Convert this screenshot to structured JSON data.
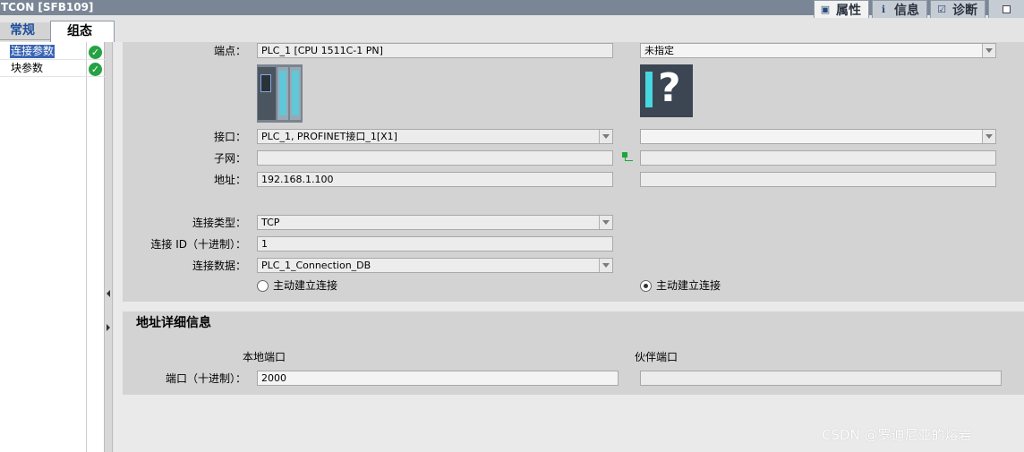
{
  "window": {
    "title": "TCON [SFB109]",
    "right_tabs": [
      {
        "label": "属性",
        "icon": "properties-icon",
        "active": true
      },
      {
        "label": "信息",
        "icon": "info-icon",
        "active": false
      },
      {
        "label": "诊断",
        "icon": "diagnostics-icon",
        "active": false
      }
    ]
  },
  "tabs": {
    "general": "常规",
    "config": "组态"
  },
  "sidebar": {
    "items": [
      {
        "label": "连接参数",
        "selected": true,
        "status": "ok"
      },
      {
        "label": "块参数",
        "selected": false,
        "status": "ok"
      }
    ]
  },
  "connection": {
    "endpoint_label": "端点：",
    "endpoint_local": "PLC_1 [CPU 1511C-1 PN]",
    "endpoint_partner": "未指定",
    "interface_label": "接口：",
    "interface_local": "PLC_1, PROFINET接口_1[X1]",
    "interface_partner": "",
    "subnet_label": "子网：",
    "subnet_local": "",
    "subnet_partner": "",
    "address_label": "地址：",
    "address_local": "192.168.1.100",
    "address_partner": "",
    "conn_type_label": "连接类型：",
    "conn_type": "TCP",
    "conn_id_label": "连接 ID（十进制）：",
    "conn_id": "1",
    "conn_data_label": "连接数据：",
    "conn_data": "PLC_1_Connection_DB",
    "active_local_label": "主动建立连接",
    "active_local_checked": false,
    "active_partner_label": "主动建立连接",
    "active_partner_checked": true
  },
  "address_details": {
    "title": "地址详细信息",
    "local_port_header": "本地端口",
    "partner_port_header": "伙伴端口",
    "port_label": "端口（十进制）：",
    "local_port": "2000",
    "partner_port": ""
  },
  "watermark": "CSDN @罗迪尼亚的熔岩"
}
